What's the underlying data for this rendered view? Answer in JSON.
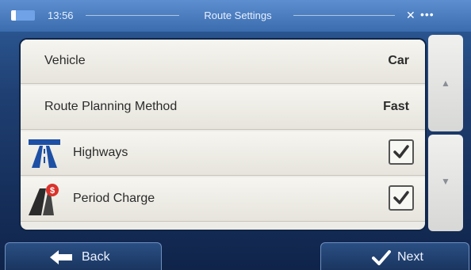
{
  "status_bar": {
    "time": "13:56",
    "title": "Route Settings",
    "icons": [
      "battery-icon",
      "signal-icon",
      "menu-dots-icon"
    ]
  },
  "settings": {
    "vehicle": {
      "label": "Vehicle",
      "value": "Car"
    },
    "route_planning": {
      "label": "Route Planning Method",
      "value": "Fast"
    },
    "highways": {
      "label": "Highways",
      "checked": true,
      "icon": "highway-icon"
    },
    "period_charge": {
      "label": "Period Charge",
      "checked": true,
      "icon": "toll-road-icon"
    }
  },
  "scroll": {
    "up": "▲",
    "down": "▼"
  },
  "footer": {
    "back_label": "Back",
    "next_label": "Next"
  },
  "colors": {
    "accent": "#3a6cae",
    "panel": "#ecebe5",
    "toll_red": "#d9332b",
    "highway_blue": "#1d4fa5"
  }
}
